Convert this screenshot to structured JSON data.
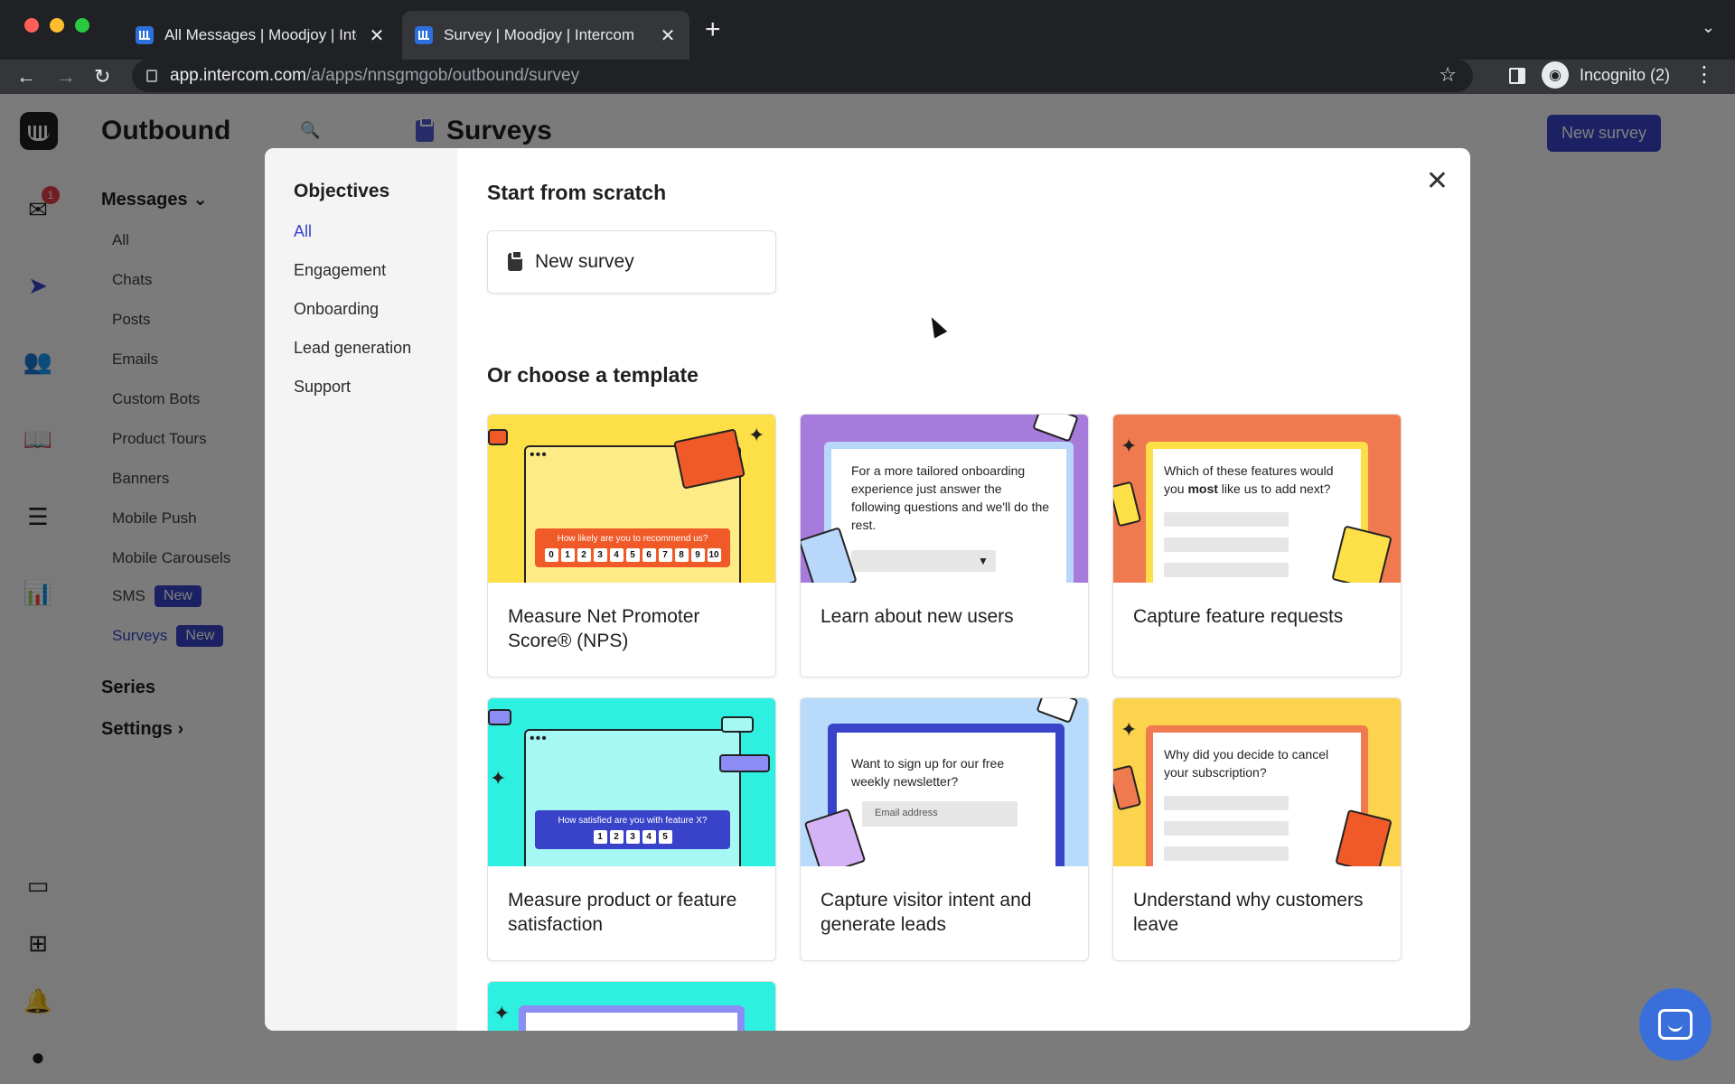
{
  "browser": {
    "tabs": [
      {
        "title": "All Messages | Moodjoy | Interc",
        "active": false
      },
      {
        "title": "Survey | Moodjoy | Intercom",
        "active": true
      }
    ],
    "url_host": "app.intercom.com",
    "url_path": "/a/apps/nnsgmgob/outbound/survey",
    "profile_label": "Incognito (2)"
  },
  "rail": {
    "inbox_badge": "1"
  },
  "sidebar": {
    "title": "Outbound",
    "messages_label": "Messages",
    "items": [
      {
        "label": "All"
      },
      {
        "label": "Chats"
      },
      {
        "label": "Posts"
      },
      {
        "label": "Emails"
      },
      {
        "label": "Custom Bots"
      },
      {
        "label": "Product Tours"
      },
      {
        "label": "Banners"
      },
      {
        "label": "Mobile Push"
      },
      {
        "label": "Mobile Carousels"
      },
      {
        "label": "SMS",
        "badge": "New"
      },
      {
        "label": "Surveys",
        "badge": "New",
        "active": true
      }
    ],
    "series_label": "Series",
    "settings_label": "Settings"
  },
  "page": {
    "title": "Surveys",
    "new_survey_button": "New survey"
  },
  "modal": {
    "objectives_title": "Objectives",
    "objectives": [
      {
        "label": "All",
        "active": true
      },
      {
        "label": "Engagement"
      },
      {
        "label": "Onboarding"
      },
      {
        "label": "Lead generation"
      },
      {
        "label": "Support"
      }
    ],
    "scratch_title": "Start from scratch",
    "scratch_button": "New survey",
    "template_title": "Or choose a template",
    "templates": [
      {
        "label": "Measure Net Promoter Score® (NPS)",
        "art_text": "How likely are you to recommend us?",
        "scale": [
          "0",
          "1",
          "2",
          "3",
          "4",
          "5",
          "6",
          "7",
          "8",
          "9",
          "10"
        ]
      },
      {
        "label": "Learn about new users",
        "art_text": "For a more tailored onboarding experience just answer the following questions and we'll do the rest."
      },
      {
        "label": "Capture feature requests",
        "art_text_pre": "Which of these features would you ",
        "art_text_bold": "most",
        "art_text_post": " like us to add next?"
      },
      {
        "label": "Measure product or feature satisfaction",
        "art_text": "How satisfied are you with feature X?",
        "scale": [
          "1",
          "2",
          "3",
          "4",
          "5"
        ]
      },
      {
        "label": "Capture visitor intent and generate leads",
        "art_text": "Want to sign up for our free weekly newsletter?",
        "input_placeholder": "Email address"
      },
      {
        "label": "Understand why customers leave",
        "art_text": "Why did you decide to cancel your subscription?"
      }
    ]
  },
  "colors": {
    "accent": "#3843c9",
    "nps_bg": "#fde047",
    "users_bg": "#a77bdb",
    "features_bg": "#f07a4f",
    "satisfaction_bg": "#2ef0e0",
    "leads_bg": "#b8dbfb"
  }
}
